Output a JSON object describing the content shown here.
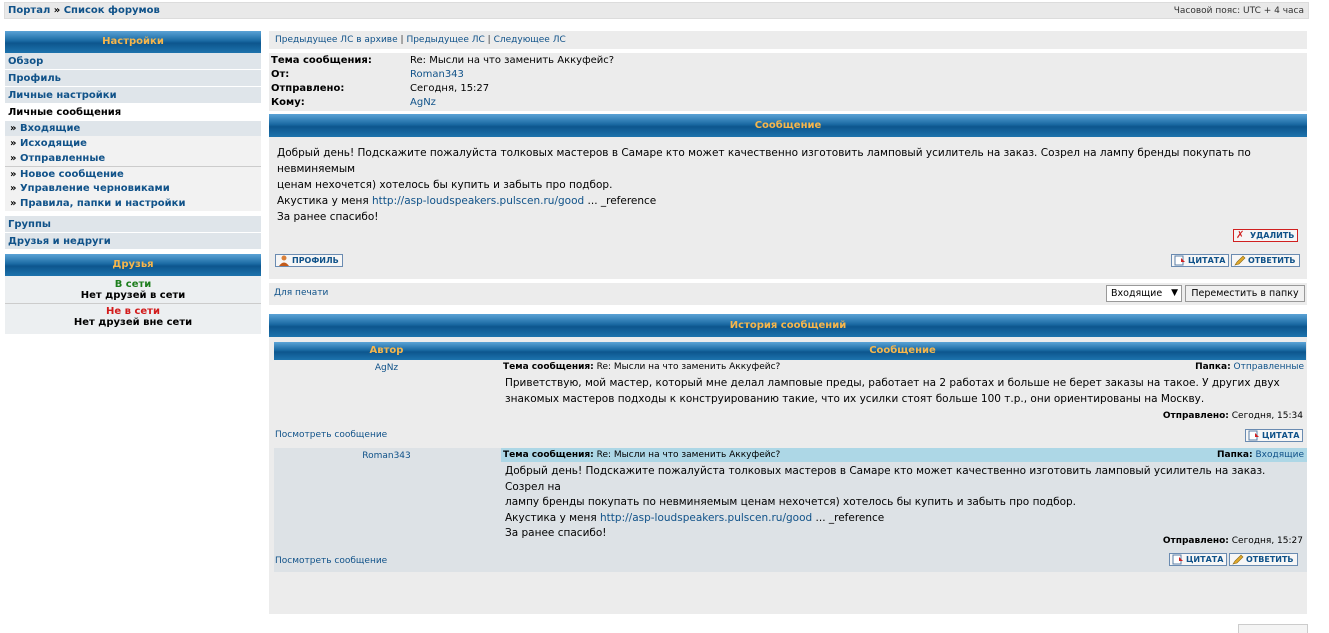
{
  "breadcrumb": {
    "portal": "Портал",
    "separator": "»",
    "forums": "Список форумов"
  },
  "timezone": "Часовой пояс: UTC + 4 часа",
  "sidebar": {
    "title": "Настройки",
    "items": [
      {
        "label": "Обзор"
      },
      {
        "label": "Профиль"
      },
      {
        "label": "Личные настройки"
      },
      {
        "label": "Личные сообщения"
      }
    ],
    "subitems": [
      {
        "bullet": "»",
        "label": "Входящие"
      },
      {
        "bullet": "»",
        "label": "Исходящие"
      },
      {
        "bullet": "»",
        "label": "Отправленные"
      },
      {
        "bullet": "»",
        "label": "Новое сообщение"
      },
      {
        "bullet": "»",
        "label": "Управление черновиками"
      },
      {
        "bullet": "»",
        "label": "Правила, папки и настройки"
      }
    ],
    "groups": "Группы",
    "friends_foes": "Друзья и недруги"
  },
  "friends": {
    "title": "Друзья",
    "online_label": "В сети",
    "online_none": "Нет друзей в сети",
    "offline_label": "Не в сети",
    "offline_none": "Нет друзей вне сети"
  },
  "pm_nav": {
    "prev_archive": "Предыдущее ЛС в архиве",
    "prev": "Предыдущее ЛС",
    "next": "Следующее ЛС",
    "sep": "|"
  },
  "meta": {
    "subject_label": "Тема сообщения:",
    "subject": "Re: Мысли на что заменить Аккуфейс?",
    "from_label": "От:",
    "from": "Roman343",
    "sent_label": "Отправлено:",
    "sent": "Сегодня, 15:27",
    "to_label": "Кому:",
    "to": "AgNz"
  },
  "message": {
    "title": "Сообщение",
    "line1": "Добрый день! Подскажите пожалуйста толковых мастеров в Самаре кто может качественно изготовить ламповый усилитель на заказ. Созрел на лампу бренды покупать по невминяемым",
    "line2": "ценам нехочется) хотелось бы купить и забыть про подбор.",
    "line3_prefix": "Акустика у меня",
    "link": "http://asp-loudspeakers.pulscen.ru/good",
    "line3_suffix": "... _reference",
    "line4": "За ранее спасибо!",
    "delete_btn": "УДАЛИТЬ",
    "profile_btn": "ПРОФИЛЬ",
    "quote_btn": "ЦИТАТА",
    "reply_btn": "ОТВЕТИТЬ"
  },
  "printbar": {
    "print": "Для печати",
    "folder_select": "Входящие",
    "move_btn": "Переместить в папку"
  },
  "history": {
    "title": "История сообщений",
    "col_author": "Автор",
    "col_message": "Сообщение",
    "entries": [
      {
        "author": "AgNz",
        "subject_label": "Тема сообщения:",
        "subject": "Re: Мысли на что заменить Аккуфейс?",
        "folder_label": "Папка:",
        "folder": "Отправленные",
        "line1": "Приветствую, мой мастер, который мне делал ламповые преды, работает на 2 работах и больше не берет заказы на такое. У других двух",
        "line2": "знакомых мастеров подходы к конструированию такие, что их усилки стоят больше 100 т.р., они ориентированы на Москву.",
        "sent_label": "Отправлено:",
        "sent": "Сегодня, 15:34",
        "view": "Посмотреть сообщение",
        "quote_btn": "ЦИТАТА"
      },
      {
        "author": "Roman343",
        "subject_label": "Тема сообщения:",
        "subject": "Re: Мысли на что заменить Аккуфейс?",
        "folder_label": "Папка:",
        "folder": "Входящие",
        "line1": "Добрый день! Подскажите пожалуйста толковых мастеров в Самаре кто может качественно изготовить ламповый усилитель на заказ. Созрел на",
        "line2": "лампу бренды покупать по невминяемым ценам нехочется) хотелось бы купить и забыть про подбор.",
        "line3_prefix": "Акустика у меня",
        "link": "http://asp-loudspeakers.pulscen.ru/good",
        "line3_suffix": "... _reference",
        "line4": "За ранее спасибо!",
        "sent_label": "Отправлено:",
        "sent": "Сегодня, 15:27",
        "view": "Посмотреть сообщение",
        "quote_btn": "ЦИТАТА",
        "reply_btn": "ОТВЕТИТЬ"
      }
    ]
  }
}
